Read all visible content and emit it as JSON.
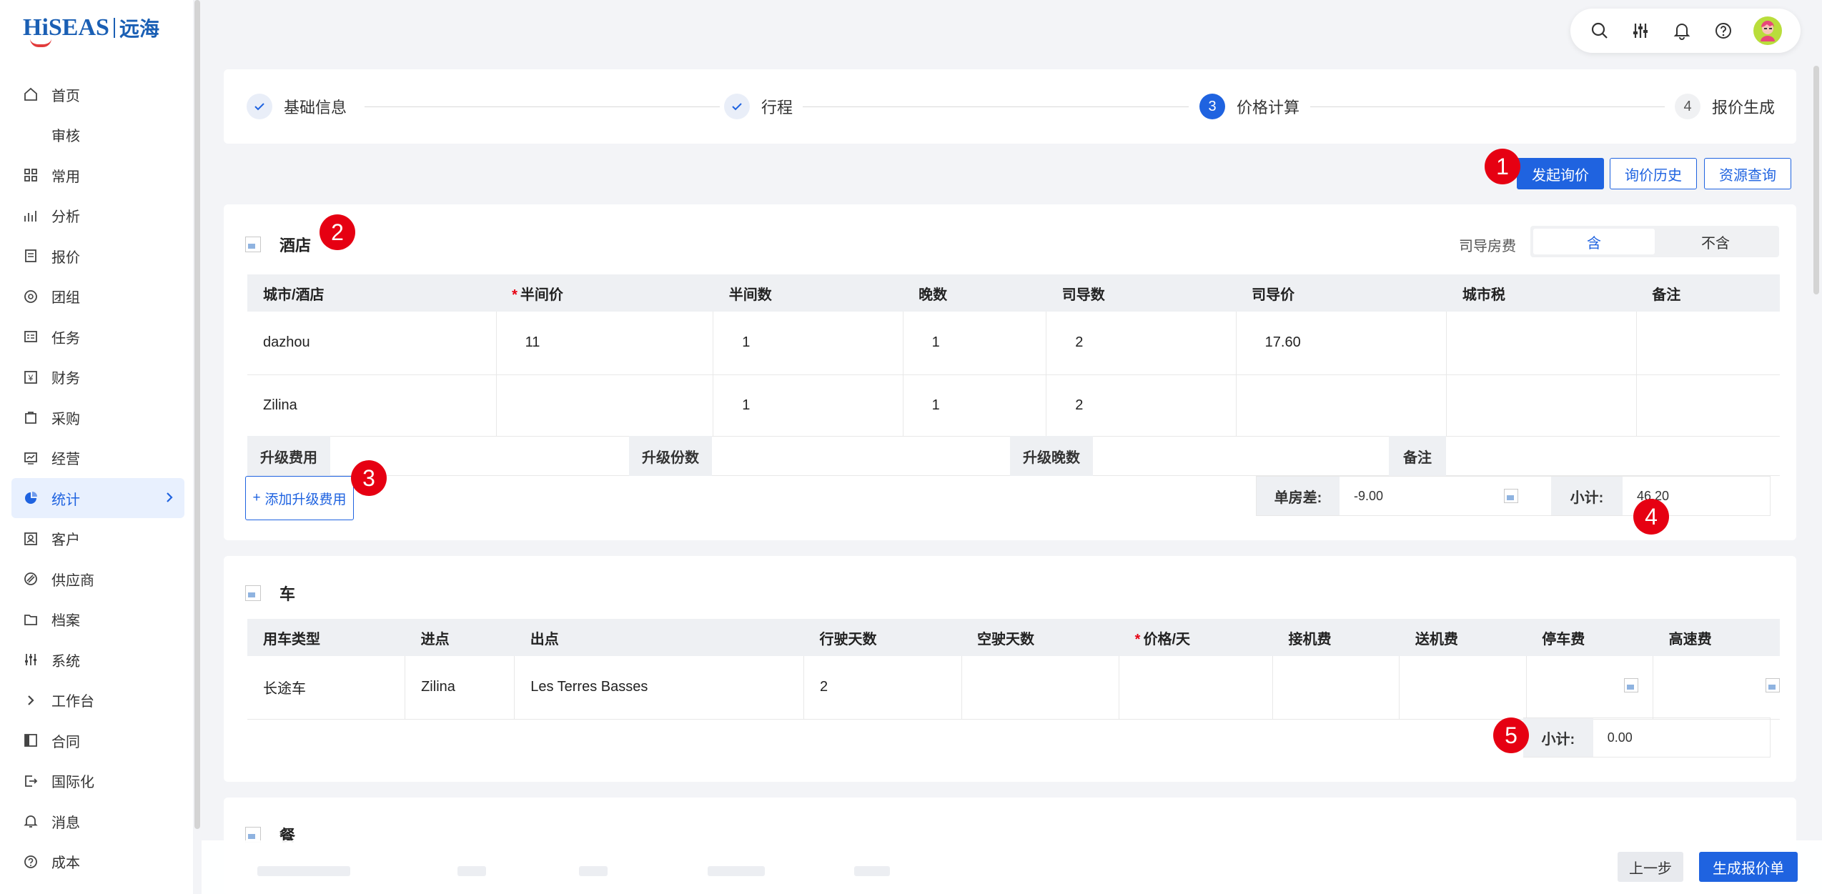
{
  "logo": {
    "brand": "HiSEAS",
    "cn": "远海"
  },
  "sidebar": {
    "items": [
      {
        "label": "首页",
        "icon": "home-icon"
      },
      {
        "label": "审核",
        "icon": ""
      },
      {
        "label": "常用",
        "icon": "grid-icon"
      },
      {
        "label": "分析",
        "icon": "analysis-icon"
      },
      {
        "label": "报价",
        "icon": "quote-icon"
      },
      {
        "label": "团组",
        "icon": "group-icon"
      },
      {
        "label": "任务",
        "icon": "task-icon"
      },
      {
        "label": "财务",
        "icon": "finance-icon"
      },
      {
        "label": "采购",
        "icon": "purchase-icon"
      },
      {
        "label": "经营",
        "icon": "operation-icon"
      },
      {
        "label": "统计",
        "icon": "stats-icon",
        "active": true
      },
      {
        "label": "客户",
        "icon": "customer-icon"
      },
      {
        "label": "供应商",
        "icon": "supplier-icon"
      },
      {
        "label": "档案",
        "icon": "archive-icon"
      },
      {
        "label": "系统",
        "icon": "system-icon"
      },
      {
        "label": "工作台",
        "icon": "chevron-right-icon"
      },
      {
        "label": "合同",
        "icon": "contract-icon"
      },
      {
        "label": "国际化",
        "icon": "i18n-icon"
      },
      {
        "label": "消息",
        "icon": "bell-icon"
      },
      {
        "label": "成本",
        "icon": "help-icon"
      }
    ]
  },
  "steps": [
    {
      "label": "基础信息",
      "state": "done"
    },
    {
      "label": "行程",
      "state": "done"
    },
    {
      "label": "价格计算",
      "state": "current",
      "num": "3"
    },
    {
      "label": "报价生成",
      "state": "next",
      "num": "4"
    }
  ],
  "actions": {
    "inquiry": "发起询价",
    "history": "询价历史",
    "resource": "资源查询"
  },
  "badges": [
    "1",
    "2",
    "3",
    "4",
    "5"
  ],
  "hotel": {
    "title": "酒店",
    "driver_room_label": "司导房费",
    "seg_on": "含",
    "seg_off": "不含",
    "headers": [
      "城市/酒店",
      "半间价",
      "半间数",
      "晚数",
      "司导数",
      "司导价",
      "城市税",
      "备注"
    ],
    "rows": [
      [
        "dazhou",
        "11",
        "1",
        "1",
        "2",
        "17.60",
        "",
        ""
      ],
      [
        "Zilina",
        "",
        "1",
        "1",
        "2",
        "",
        "",
        ""
      ]
    ],
    "upgrade": {
      "fee": "升级费用",
      "count": "升级份数",
      "nights": "升级晚数",
      "remark": "备注"
    },
    "add_upgrade": "添加升级费用",
    "single_diff_label": "单房差:",
    "single_diff_value": "-9.00",
    "subtotal_label": "小计:",
    "subtotal_value": "46.20"
  },
  "car": {
    "title": "车",
    "headers": [
      "用车类型",
      "进点",
      "出点",
      "行驶天数",
      "空驶天数",
      "价格/天",
      "接机费",
      "送机费",
      "停车费",
      "高速费"
    ],
    "rows": [
      [
        "长途车",
        "Zilina",
        "Les Terres Basses",
        "2",
        "",
        "",
        "",
        "",
        "",
        ""
      ]
    ],
    "subtotal_label": "小计:",
    "subtotal_value": "0.00"
  },
  "meal": {
    "title": "餐"
  },
  "footer": {
    "prev": "上一步",
    "generate": "生成报价单"
  },
  "colors": {
    "primary": "#1f63e0",
    "badge": "#e60012"
  }
}
